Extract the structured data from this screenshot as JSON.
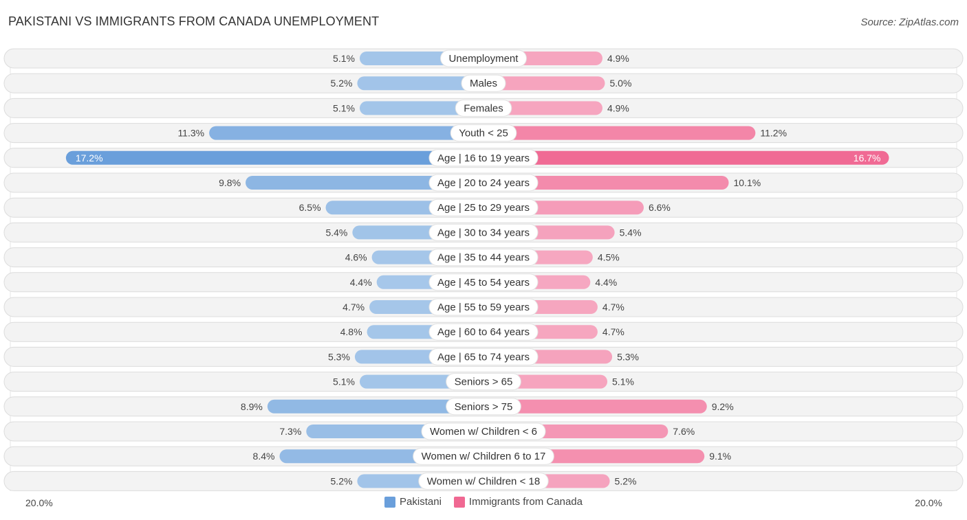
{
  "header": {
    "title": "PAKISTANI VS IMMIGRANTS FROM CANADA UNEMPLOYMENT",
    "source": "Source: ZipAtlas.com"
  },
  "colors": {
    "left_light": "#a8c8ea",
    "left_strong": "#6a9fdb",
    "right_light": "#f6a9c2",
    "right_strong": "#f06892"
  },
  "chart_data": {
    "type": "bar",
    "orientation": "horizontal-diverging",
    "title": "PAKISTANI VS IMMIGRANTS FROM CANADA UNEMPLOYMENT",
    "categories": [
      "Unemployment",
      "Males",
      "Females",
      "Youth < 25",
      "Age | 16 to 19 years",
      "Age | 20 to 24 years",
      "Age | 25 to 29 years",
      "Age | 30 to 34 years",
      "Age | 35 to 44 years",
      "Age | 45 to 54 years",
      "Age | 55 to 59 years",
      "Age | 60 to 64 years",
      "Age | 65 to 74 years",
      "Seniors > 65",
      "Seniors > 75",
      "Women w/ Children < 6",
      "Women w/ Children 6 to 17",
      "Women w/ Children < 18"
    ],
    "series": [
      {
        "name": "Pakistani",
        "side": "left",
        "values": [
          5.1,
          5.2,
          5.1,
          11.3,
          17.2,
          9.8,
          6.5,
          5.4,
          4.6,
          4.4,
          4.7,
          4.8,
          5.3,
          5.1,
          8.9,
          7.3,
          8.4,
          5.2
        ]
      },
      {
        "name": "Immigrants from Canada",
        "side": "right",
        "values": [
          4.9,
          5.0,
          4.9,
          11.2,
          16.7,
          10.1,
          6.6,
          5.4,
          4.5,
          4.4,
          4.7,
          4.7,
          5.3,
          5.1,
          9.2,
          7.6,
          9.1,
          5.2
        ]
      }
    ],
    "value_format": "{v}%",
    "axis_max": 20.0,
    "axis_labels": {
      "left": "20.0%",
      "right": "20.0%"
    },
    "legend": {
      "placement": "bottom-center",
      "entries": [
        "Pakistani",
        "Immigrants from Canada"
      ]
    }
  }
}
